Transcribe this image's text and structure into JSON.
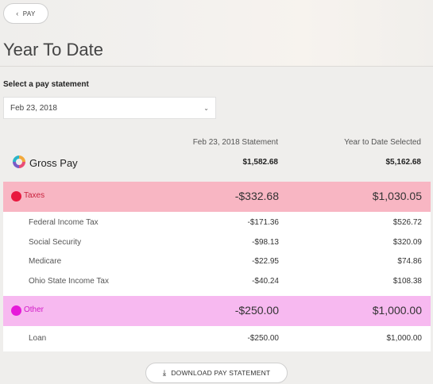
{
  "nav": {
    "back_label": "PAY",
    "back_icon": "chevron-left-icon"
  },
  "page": {
    "title": "Year To Date"
  },
  "selector": {
    "label": "Select a pay statement",
    "selected": "Feb 23, 2018",
    "icon": "chevron-down-icon"
  },
  "columns": {
    "statement": "Feb 23, 2018 Statement",
    "ytd": "Year to Date Selected"
  },
  "gross_pay": {
    "label": "Gross Pay",
    "statement": "$1,582.68",
    "ytd": "$5,162.68"
  },
  "taxes": {
    "label": "Taxes",
    "color": "#e8183e",
    "band_color": "#f8b6c3",
    "statement": "-$332.68",
    "ytd": "$1,030.05",
    "items": [
      {
        "name": "Federal Income Tax",
        "statement": "-$171.36",
        "ytd": "$526.72"
      },
      {
        "name": "Social Security",
        "statement": "-$98.13",
        "ytd": "$320.09"
      },
      {
        "name": "Medicare",
        "statement": "-$22.95",
        "ytd": "$74.86"
      },
      {
        "name": "Ohio State Income Tax",
        "statement": "-$40.24",
        "ytd": "$108.38"
      }
    ]
  },
  "other": {
    "label": "Other",
    "color": "#e61ad9",
    "band_color": "#f7b9f0",
    "statement": "-$250.00",
    "ytd": "$1,000.00",
    "items": [
      {
        "name": "Loan",
        "statement": "-$250.00",
        "ytd": "$1,000.00"
      }
    ]
  },
  "actions": {
    "download_label": "DOWNLOAD PAY STATEMENT",
    "download_icon": "download-icon"
  }
}
